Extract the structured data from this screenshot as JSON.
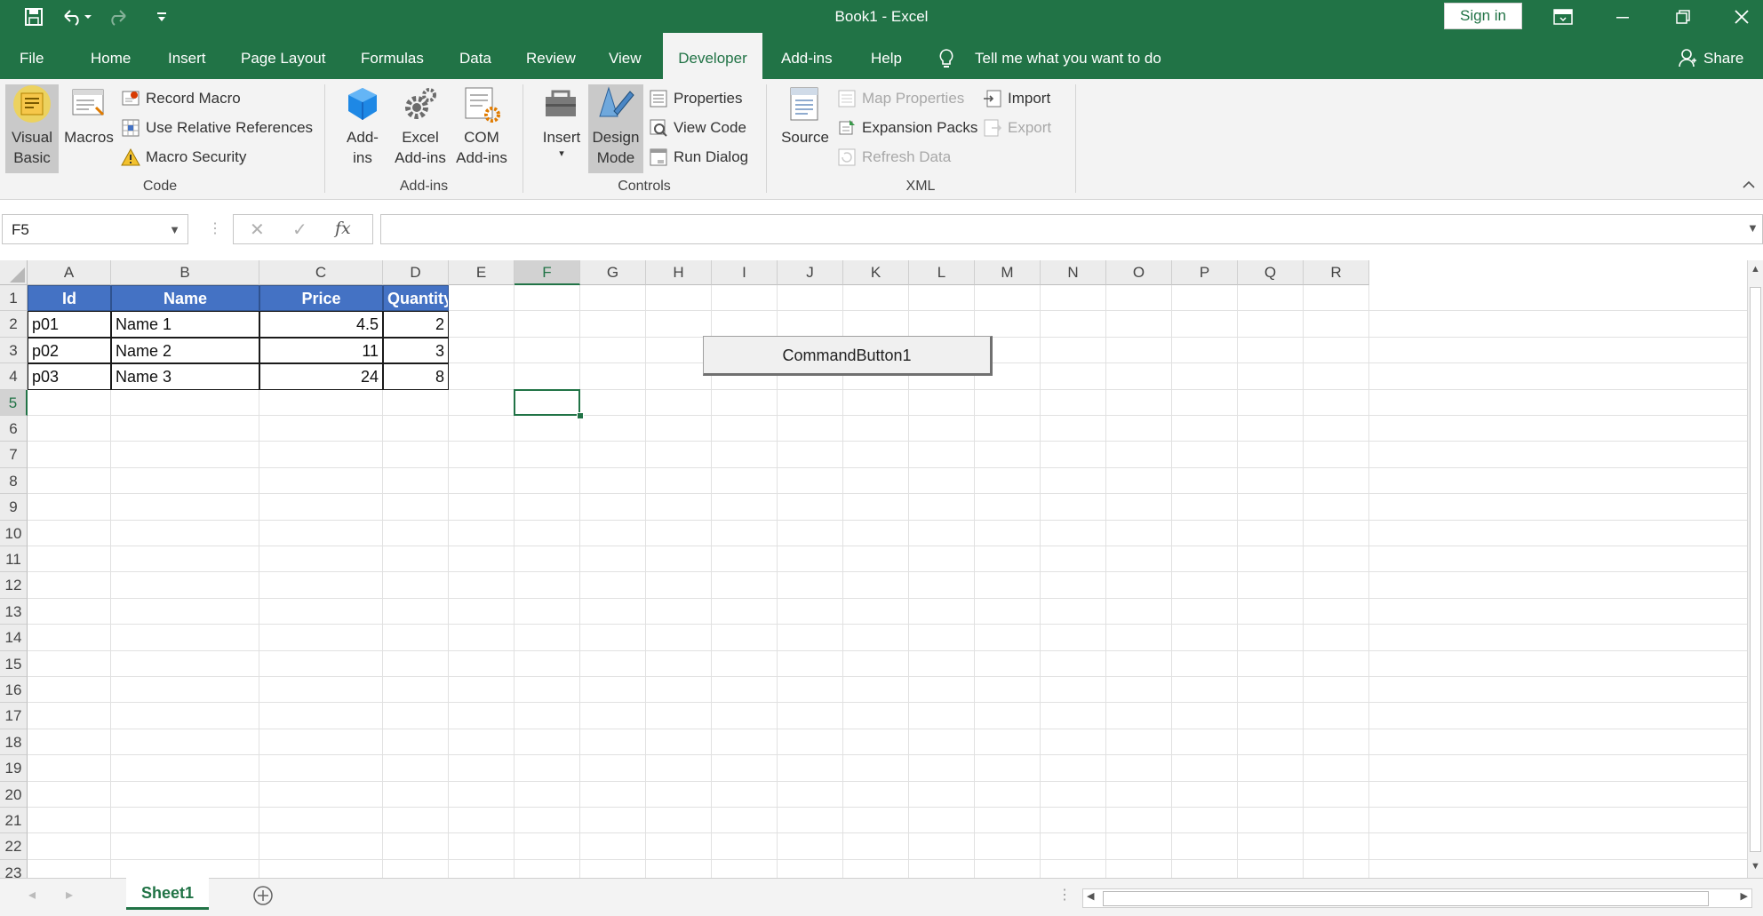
{
  "titlebar": {
    "title": "Book1  -  Excel",
    "sign_in": "Sign in"
  },
  "tabs": [
    {
      "label": "File"
    },
    {
      "label": "Home"
    },
    {
      "label": "Insert"
    },
    {
      "label": "Page Layout"
    },
    {
      "label": "Formulas"
    },
    {
      "label": "Data"
    },
    {
      "label": "Review"
    },
    {
      "label": "View"
    },
    {
      "label": "Developer"
    },
    {
      "label": "Add-ins"
    },
    {
      "label": "Help"
    }
  ],
  "active_tab": "Developer",
  "tell_me": "Tell me what you want to do",
  "share": "Share",
  "ribbon": {
    "code": {
      "label": "Code",
      "visual_basic": "Visual Basic",
      "macros": "Macros",
      "record_macro": "Record Macro",
      "use_relative": "Use Relative References",
      "macro_security": "Macro Security"
    },
    "addins": {
      "label": "Add-ins",
      "addins": "Add-ins",
      "excel_addins": "Excel Add-ins",
      "com_addins": "COM Add-ins"
    },
    "controls": {
      "label": "Controls",
      "insert": "Insert",
      "design_mode": "Design Mode",
      "properties": "Properties",
      "view_code": "View Code",
      "run_dialog": "Run Dialog"
    },
    "xml": {
      "label": "XML",
      "source": "Source",
      "map_properties": "Map Properties",
      "expansion_packs": "Expansion Packs",
      "refresh_data": "Refresh Data",
      "import": "Import",
      "export": "Export"
    }
  },
  "formula_bar": {
    "name_box": "F5",
    "fx": "fx",
    "content": ""
  },
  "columns": [
    "A",
    "B",
    "C",
    "D",
    "E",
    "F",
    "G",
    "H",
    "I",
    "J",
    "K",
    "L",
    "M",
    "N",
    "O",
    "P",
    "Q",
    "R"
  ],
  "rows": [
    "1",
    "2",
    "3",
    "4",
    "5",
    "6",
    "7",
    "8",
    "9",
    "10",
    "11",
    "12",
    "13",
    "14",
    "15",
    "16",
    "17",
    "18",
    "19",
    "20",
    "21",
    "22",
    "23"
  ],
  "table": {
    "headers": [
      "Id",
      "Name",
      "Price",
      "Quantity"
    ],
    "rows": [
      [
        "p01",
        "Name 1",
        "4.5",
        "2"
      ],
      [
        "p02",
        "Name 2",
        "11",
        "3"
      ],
      [
        "p03",
        "Name 3",
        "24",
        "8"
      ]
    ]
  },
  "command_button": "CommandButton1",
  "sheet_tab": "Sheet1",
  "colors": {
    "brand": "#217346",
    "table_header": "#4472c4"
  }
}
